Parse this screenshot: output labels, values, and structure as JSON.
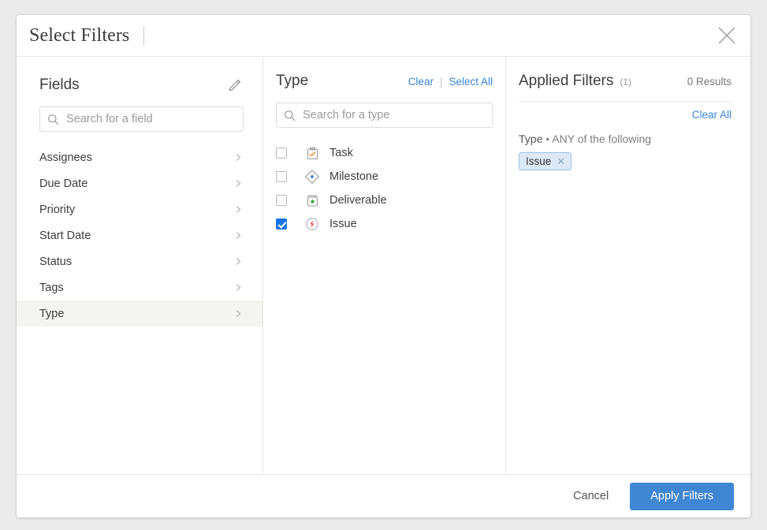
{
  "dialog": {
    "title": "Select Filters",
    "close_icon": "close-icon"
  },
  "fields_panel": {
    "title": "Fields",
    "edit_icon": "pencil-icon",
    "search": {
      "placeholder": "Search for a field",
      "value": "",
      "icon": "search-icon"
    },
    "items": [
      {
        "label": "Assignees",
        "selected": false
      },
      {
        "label": "Due Date",
        "selected": false
      },
      {
        "label": "Priority",
        "selected": false
      },
      {
        "label": "Start Date",
        "selected": false
      },
      {
        "label": "Status",
        "selected": false
      },
      {
        "label": "Tags",
        "selected": false
      },
      {
        "label": "Type",
        "selected": true
      }
    ]
  },
  "type_panel": {
    "title": "Type",
    "clear_label": "Clear",
    "separator": "|",
    "select_all_label": "Select All",
    "search": {
      "placeholder": "Search for a type",
      "value": "",
      "icon": "search-icon"
    },
    "options": [
      {
        "label": "Task",
        "checked": false,
        "icon": "task-clipboard-icon"
      },
      {
        "label": "Milestone",
        "checked": false,
        "icon": "milestone-diamond-icon"
      },
      {
        "label": "Deliverable",
        "checked": false,
        "icon": "deliverable-box-star-icon"
      },
      {
        "label": "Issue",
        "checked": true,
        "icon": "issue-bolt-icon"
      }
    ]
  },
  "applied_panel": {
    "title": "Applied Filters",
    "count": "(1)",
    "results": "0 Results",
    "clear_all_label": "Clear All",
    "group": {
      "field": "Type",
      "bullet": "•",
      "condition": "ANY of the following",
      "chips": [
        {
          "label": "Issue",
          "remove_icon": "close-icon"
        }
      ]
    }
  },
  "footer": {
    "cancel_label": "Cancel",
    "apply_label": "Apply Filters"
  },
  "colors": {
    "accent_blue": "#3f86d3",
    "link_blue": "#3b84d8",
    "checkbox_blue": "#1a73e8",
    "chip_bg": "#dce9f7",
    "chip_border": "#9dc0e6",
    "selected_row": "#f4f4f1",
    "page_bg": "#ebebeb",
    "task_orange": "#f0912d",
    "milestone_blue": "#3b7fd4",
    "deliverable_green": "#3aa33a",
    "issue_red": "#ef5b52"
  }
}
